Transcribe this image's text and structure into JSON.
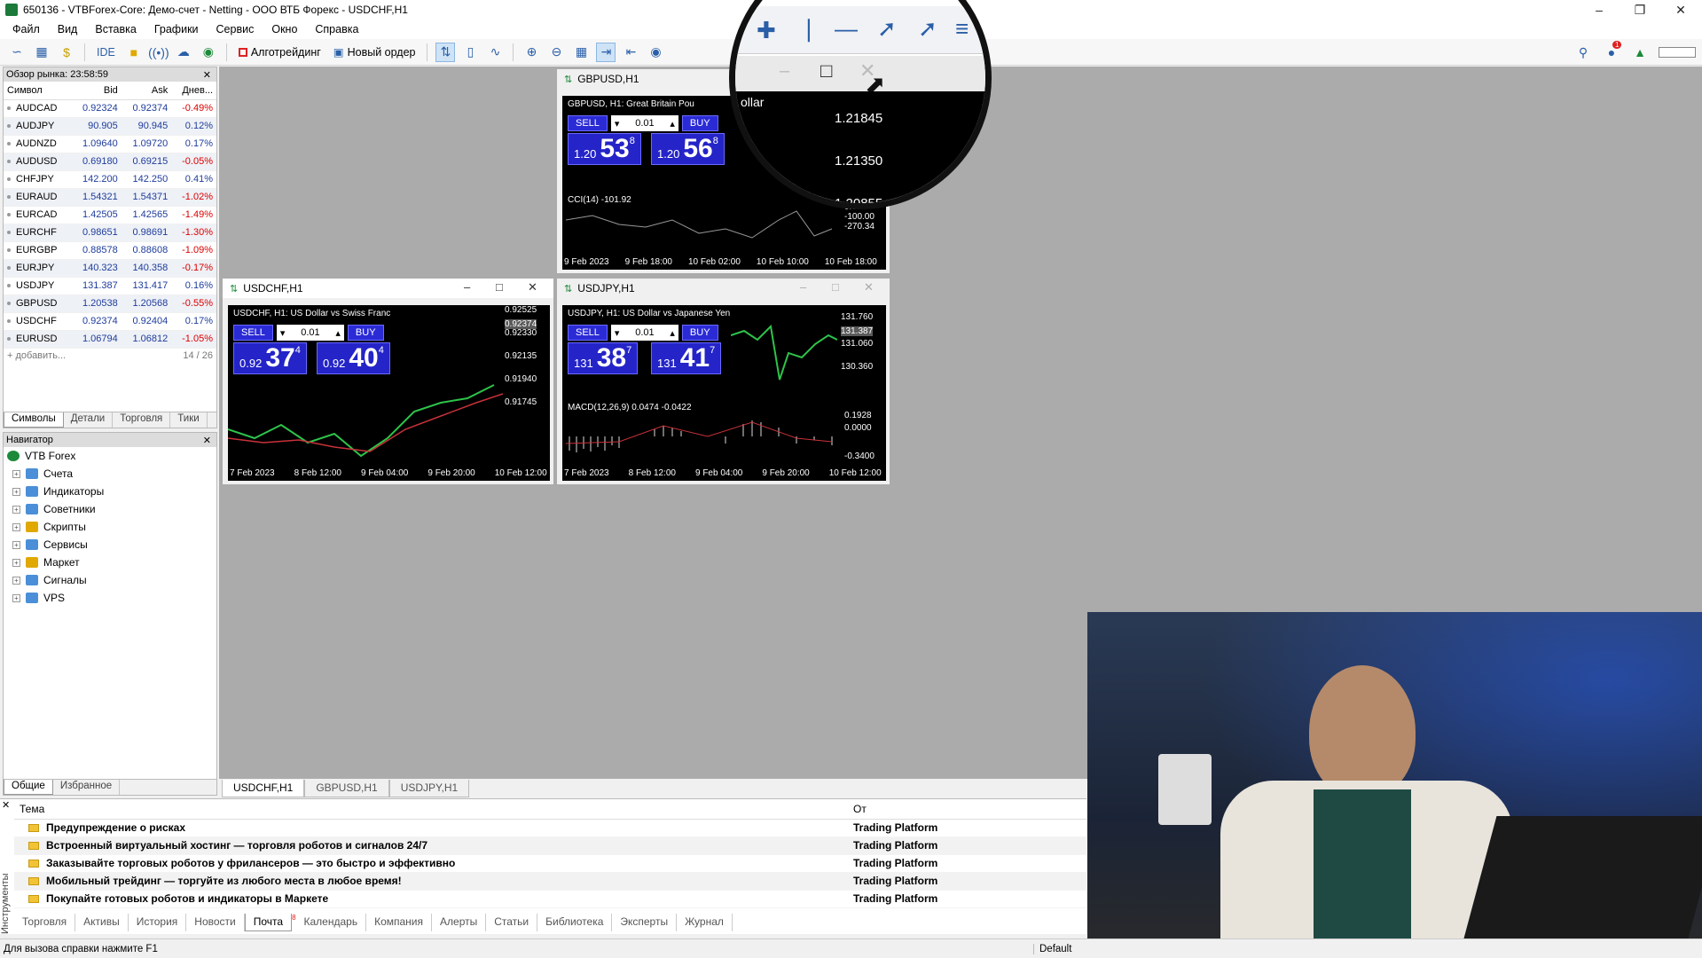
{
  "window": {
    "title": "650136 - VTBForex-Core: Демо-счет - Netting - ООО ВТБ Форекс - USDCHF,H1"
  },
  "menu": [
    "Файл",
    "Вид",
    "Вставка",
    "Графики",
    "Сервис",
    "Окно",
    "Справка"
  ],
  "toolbar": {
    "ide": "IDE",
    "algo": "Алготрейдинг",
    "new_order": "Новый ордер",
    "notif_count": "1"
  },
  "market_watch": {
    "title": "Обзор рынка: 23:58:59",
    "cols": [
      "Символ",
      "Bid",
      "Ask",
      "Днев..."
    ],
    "rows": [
      {
        "s": "AUDCAD",
        "bid": "0.92324",
        "ask": "0.92374",
        "chg": "-0.49%"
      },
      {
        "s": "AUDJPY",
        "bid": "90.905",
        "ask": "90.945",
        "chg": "0.12%"
      },
      {
        "s": "AUDNZD",
        "bid": "1.09640",
        "ask": "1.09720",
        "chg": "0.17%"
      },
      {
        "s": "AUDUSD",
        "bid": "0.69180",
        "ask": "0.69215",
        "chg": "-0.05%"
      },
      {
        "s": "CHFJPY",
        "bid": "142.200",
        "ask": "142.250",
        "chg": "0.41%"
      },
      {
        "s": "EURAUD",
        "bid": "1.54321",
        "ask": "1.54371",
        "chg": "-1.02%"
      },
      {
        "s": "EURCAD",
        "bid": "1.42505",
        "ask": "1.42565",
        "chg": "-1.49%"
      },
      {
        "s": "EURCHF",
        "bid": "0.98651",
        "ask": "0.98691",
        "chg": "-1.30%"
      },
      {
        "s": "EURGBP",
        "bid": "0.88578",
        "ask": "0.88608",
        "chg": "-1.09%"
      },
      {
        "s": "EURJPY",
        "bid": "140.323",
        "ask": "140.358",
        "chg": "-0.17%"
      },
      {
        "s": "USDJPY",
        "bid": "131.387",
        "ask": "131.417",
        "chg": "0.16%"
      },
      {
        "s": "GBPUSD",
        "bid": "1.20538",
        "ask": "1.20568",
        "chg": "-0.55%"
      },
      {
        "s": "USDCHF",
        "bid": "0.92374",
        "ask": "0.92404",
        "chg": "0.17%"
      },
      {
        "s": "EURUSD",
        "bid": "1.06794",
        "ask": "1.06812",
        "chg": "-1.05%"
      }
    ],
    "add": "+ добавить...",
    "count": "14 / 26",
    "tabs": [
      "Символы",
      "Детали",
      "Торговля",
      "Тики"
    ]
  },
  "navigator": {
    "title": "Навигатор",
    "root": "VTB Forex",
    "items": [
      "Счета",
      "Индикаторы",
      "Советники",
      "Скрипты",
      "Сервисы",
      "Маркет",
      "Сигналы",
      "VPS"
    ],
    "tabs": [
      "Общие",
      "Избранное"
    ]
  },
  "charts": [
    {
      "title": "GBPUSD,H1",
      "desc": "GBPUSD, H1:  Great Britain Pou",
      "lot": "0.01",
      "sell": "SELL",
      "buy": "BUY",
      "sell_small": "1.20",
      "sell_big": "53",
      "sell_pip": "8",
      "buy_small": "1.20",
      "buy_big": "56",
      "buy_pip": "8",
      "axis": [
        "1.21845",
        "1.21350",
        "1.20855"
      ],
      "ind": "CCI(14) -101.92",
      "ind_axis": [
        "0.00",
        "-100.00",
        "-270.34"
      ],
      "dates": [
        "9 Feb 2023",
        "9 Feb 18:00",
        "10 Feb 02:00",
        "10 Feb 10:00",
        "10 Feb 18:00"
      ]
    },
    {
      "title": "USDCHF,H1",
      "desc": "USDCHF, H1:  US Dollar vs Swiss Franc",
      "lot": "0.01",
      "sell": "SELL",
      "buy": "BUY",
      "sell_small": "0.92",
      "sell_big": "37",
      "sell_pip": "4",
      "buy_small": "0.92",
      "buy_big": "40",
      "buy_pip": "4",
      "axis": [
        "0.92525",
        "0.92374",
        "0.92330",
        "0.92135",
        "0.91940",
        "0.91745"
      ],
      "dates": [
        "7 Feb 2023",
        "8 Feb 12:00",
        "9 Feb 04:00",
        "9 Feb 20:00",
        "10 Feb 12:00"
      ]
    },
    {
      "title": "USDJPY,H1",
      "desc": "USDJPY, H1:  US Dollar vs Japanese Yen",
      "lot": "0.01",
      "sell": "SELL",
      "buy": "BUY",
      "sell_small": "131",
      "sell_big": "38",
      "sell_pip": "7",
      "buy_small": "131",
      "buy_big": "41",
      "buy_pip": "7",
      "axis": [
        "131.760",
        "131.387",
        "131.060",
        "130.360"
      ],
      "ind": "MACD(12,26,9) 0.0474 -0.0422",
      "ind_axis": [
        "0.1928",
        "0.0000",
        "-0.3400"
      ],
      "dates": [
        "7 Feb 2023",
        "8 Feb 12:00",
        "9 Feb 04:00",
        "9 Feb 20:00",
        "10 Feb 12:00"
      ]
    }
  ],
  "magnifier_label": "ollar",
  "chart_tabs": [
    "USDCHF,H1",
    "GBPUSD,H1",
    "USDJPY,H1"
  ],
  "mail": {
    "col_subject": "Тема",
    "col_from": "От",
    "rows": [
      {
        "subject": "Предупреждение о рисках",
        "from": "Trading Platform"
      },
      {
        "subject": "Встроенный виртуальный хостинг — торговля роботов и сигналов 24/7",
        "from": "Trading Platform"
      },
      {
        "subject": "Заказывайте торговых роботов у фрилансеров — это быстро и эффективно",
        "from": "Trading Platform"
      },
      {
        "subject": "Мобильный трейдинг — торгуйте из любого места в любое время!",
        "from": "Trading Platform"
      },
      {
        "subject": "Покупайте готовых роботов и индикаторы в Маркете",
        "from": "Trading Platform"
      }
    ]
  },
  "toolbox_tabs": [
    "Торговля",
    "Активы",
    "История",
    "Новости",
    "Почта",
    "Календарь",
    "Компания",
    "Алерты",
    "Статьи",
    "Библиотека",
    "Эксперты",
    "Журнал"
  ],
  "toolbox_side": "Инструменты",
  "mail_badge": "8",
  "status": {
    "left": "Для вызова справки нажмите F1",
    "profile": "Default"
  }
}
